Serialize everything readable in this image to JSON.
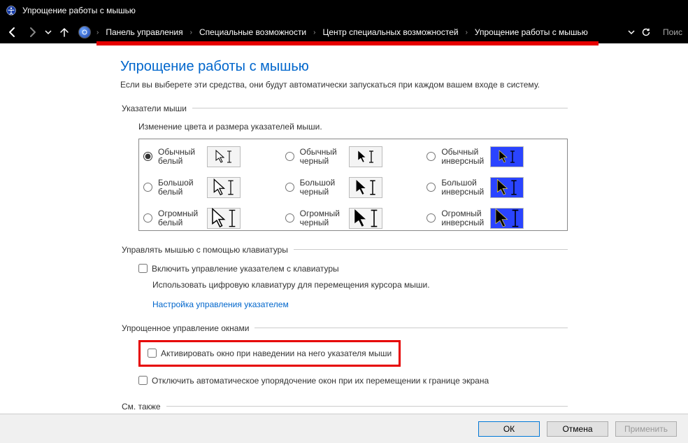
{
  "window": {
    "title": "Упрощение работы с мышью"
  },
  "nav": {
    "search_placeholder": "Поис",
    "crumbs": [
      "Панель управления",
      "Специальные возможности",
      "Центр специальных возможностей",
      "Упрощение работы с мышью"
    ]
  },
  "page": {
    "heading": "Упрощение работы с мышью",
    "description": "Если вы выберете эти средства, они будут автоматически запускаться при каждом вашем входе в систему."
  },
  "pointers": {
    "legend": "Указатели мыши",
    "sub_desc": "Изменение цвета и размера указателей мыши.",
    "options": [
      {
        "label": "Обычный белый",
        "selected": true
      },
      {
        "label": "Обычный черный",
        "selected": false
      },
      {
        "label": "Обычный инверсный",
        "selected": false
      },
      {
        "label": "Большой белый",
        "selected": false
      },
      {
        "label": "Большой черный",
        "selected": false
      },
      {
        "label": "Большой инверсный",
        "selected": false
      },
      {
        "label": "Огромный белый",
        "selected": false
      },
      {
        "label": "Огромный черный",
        "selected": false
      },
      {
        "label": "Огромный инверсный",
        "selected": false
      }
    ]
  },
  "keyboard_mouse": {
    "legend": "Управлять мышью с помощью клавиатуры",
    "checkbox": "Включить управление указателем с клавиатуры",
    "checkbox_checked": false,
    "desc": "Использовать цифровую клавиатуру для перемещения курсора мыши.",
    "link": "Настройка управления указателем"
  },
  "window_mgmt": {
    "legend": "Упрощенное управление окнами",
    "activate_hover": "Активировать окно при наведении на него указателя мыши",
    "activate_hover_checked": false,
    "disable_arrange": "Отключить автоматическое упорядочение окон при их перемещении к границе экрана",
    "disable_arrange_checked": false
  },
  "see_also": {
    "legend": "См. также"
  },
  "footer": {
    "ok": "ОК",
    "cancel": "Отмена",
    "apply": "Применить"
  }
}
